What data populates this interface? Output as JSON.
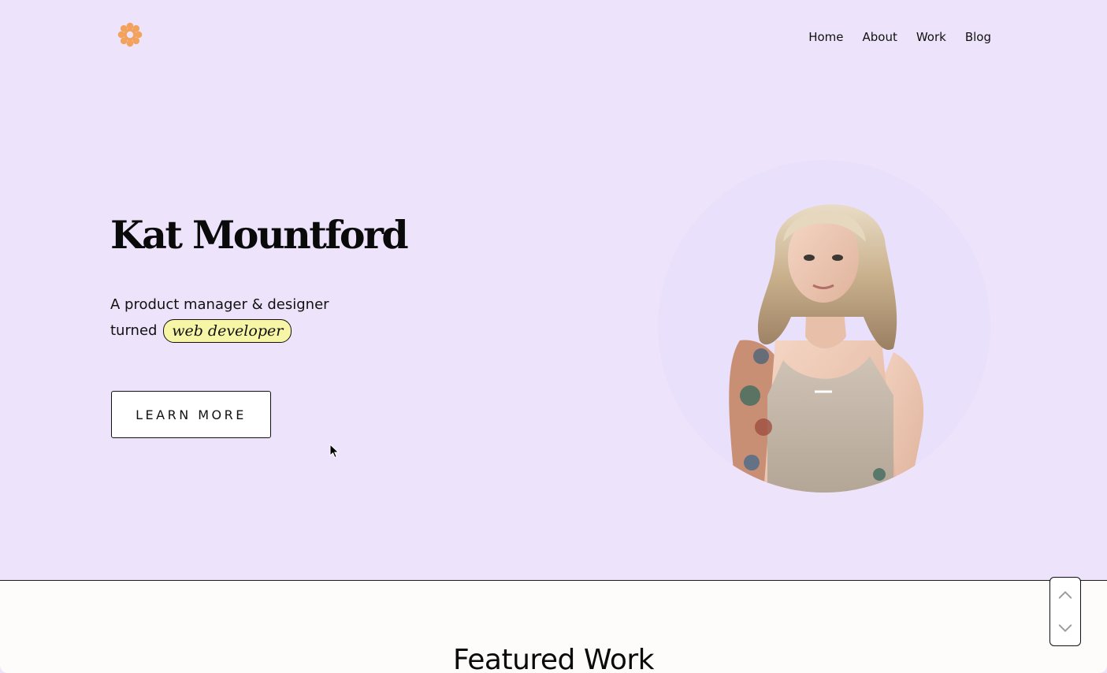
{
  "header": {
    "logo_icon": "flower-icon",
    "logo_color": "#f2a25c",
    "nav": [
      {
        "label": "Home"
      },
      {
        "label": "About"
      },
      {
        "label": "Work"
      },
      {
        "label": "Blog"
      }
    ]
  },
  "hero": {
    "title": "Kat Mountford",
    "tagline_line1": "A product manager & designer",
    "tagline_turned": "turned",
    "tagline_highlight": "web developer",
    "cta_label": "LEARN MORE",
    "background_color": "#ede4fb",
    "highlight_color": "#f7f5a6"
  },
  "featured": {
    "title": "Featured Work"
  },
  "scroll_widget": {
    "up_icon": "chevron-up-icon",
    "down_icon": "chevron-down-icon"
  }
}
